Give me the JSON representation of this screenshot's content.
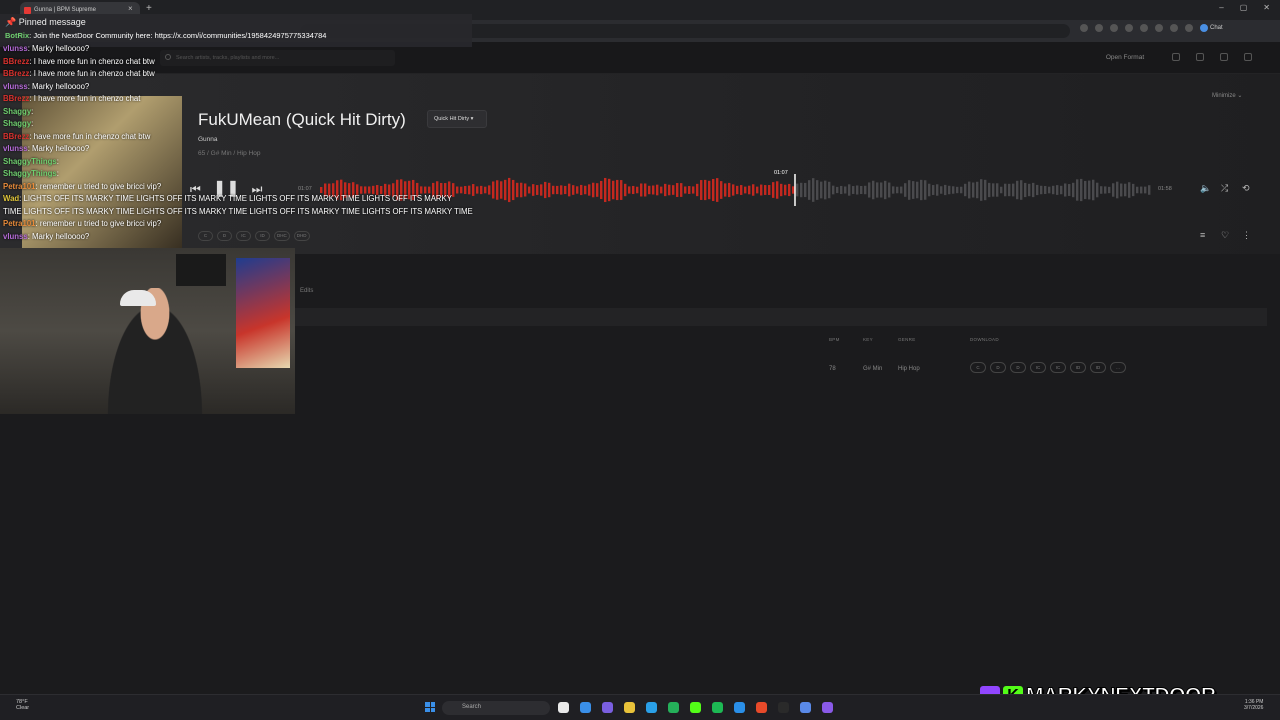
{
  "browser": {
    "tab_title": "Gunna | BPM Supreme",
    "tab_close": "×",
    "new_tab": "+",
    "chat_button": "Chat",
    "window_controls": [
      "–",
      "▢",
      "✕"
    ]
  },
  "app": {
    "search_placeholder": "Search artists, tracks, playlists and more...",
    "open_format_label": "Open Format",
    "minimize_label": "Minimize ⌄"
  },
  "track": {
    "title": "FukUMean (Quick Hit Dirty)",
    "version": "Quick Hit Dirty ▾",
    "artist": "Gunna",
    "meta": "65  /  G# Min  /  Hip Hop",
    "time_elapsed": "01:07",
    "time_total": "01:58",
    "playhead_time": "01:07",
    "progress": 0.57,
    "stems": [
      "C",
      "D",
      "IC",
      "ID",
      "DHC",
      "DHD"
    ],
    "icons": {
      "prev": "prev-icon",
      "pause": "pause-icon",
      "next": "next-icon"
    }
  },
  "table": {
    "edits_tab": "Edits",
    "headers": {
      "bpm": "BPM",
      "key": "KEY",
      "genre": "GENRE",
      "download": "DOWNLOAD"
    },
    "row": {
      "bpm": "78",
      "key": "G# Min",
      "genre": "Hip Hop"
    },
    "download_pills": [
      "C",
      "D",
      "D",
      "IC",
      "IC",
      "ID",
      "ID",
      "…"
    ]
  },
  "chat": {
    "pinned_label": "Pinned message",
    "pinned_user": "BotRix",
    "pinned_text": "Join the NextDoor Community here: https://x.com/i/communities/1958424975775334784",
    "messages": [
      {
        "user": "vlunss",
        "color": "#b56ad8",
        "text": "Marky helloooo?"
      },
      {
        "user": "BBrezz",
        "color": "#d9322e",
        "text": "I have more fun in chenzo chat btw"
      },
      {
        "user": "BBrezz",
        "color": "#d9322e",
        "text": "I have more fun in chenzo chat btw"
      },
      {
        "user": "vlunss",
        "color": "#b56ad8",
        "text": "Marky helloooo?"
      },
      {
        "user": "BBrezz",
        "color": "#d9322e",
        "text": "I have more fun in chenzo chat"
      },
      {
        "user": "Shaggy",
        "color": "#6fcf6f",
        "text": ""
      },
      {
        "user": "Shaggy",
        "color": "#6fcf6f",
        "text": ""
      },
      {
        "user": "BBrezz",
        "color": "#d9322e",
        "text": "have more fun in chenzo chat btw"
      },
      {
        "user": "vlunss",
        "color": "#b56ad8",
        "text": "Marky helloooo?"
      },
      {
        "user": "ShaggyThings",
        "color": "#6fcf6f",
        "text": ""
      },
      {
        "user": "ShaggyThings",
        "color": "#6fcf6f",
        "text": ""
      },
      {
        "user": "Petra101",
        "color": "#e88b3a",
        "text": "remember u tried to give bricci vip?"
      },
      {
        "user": "Wad",
        "color": "#e0c63a",
        "text": "LIGHTS OFF ITS MARKY TIME LIGHTS OFF ITS MARKY TIME LIGHTS OFF ITS MARKY TIME LIGHTS OFF ITS MARKY"
      },
      {
        "user": "",
        "color": "#ffffff",
        "text": "TIME LIGHTS OFF ITS MARKY TIME LIGHTS OFF ITS MARKY TIME LIGHTS OFF ITS MARKY TIME LIGHTS OFF ITS MARKY TIME"
      },
      {
        "user": "Petra101",
        "color": "#e88b3a",
        "text": "remember u tried to give bricci vip?"
      },
      {
        "user": "vlunss",
        "color": "#b56ad8",
        "text": "Marky helloooo?"
      }
    ]
  },
  "taskbar": {
    "weather_temp": "78°F",
    "weather_desc": "Clear",
    "search_placeholder": "Search",
    "time": "1:36 PM",
    "date": "3/7/2026",
    "app_colors": [
      "#e9e9e9",
      "#3a8fe8",
      "#7a5fe0",
      "#e8c23a",
      "#2aa0e8",
      "#25b05a",
      "#53fc18",
      "#1db954",
      "#2a8fe8",
      "#e84a2a",
      "#2a2a2a",
      "#5a8ae8",
      "#8a5ae8"
    ]
  },
  "brand": {
    "name": "MARKYNEXTDOOR",
    "kick_letter": "K"
  }
}
